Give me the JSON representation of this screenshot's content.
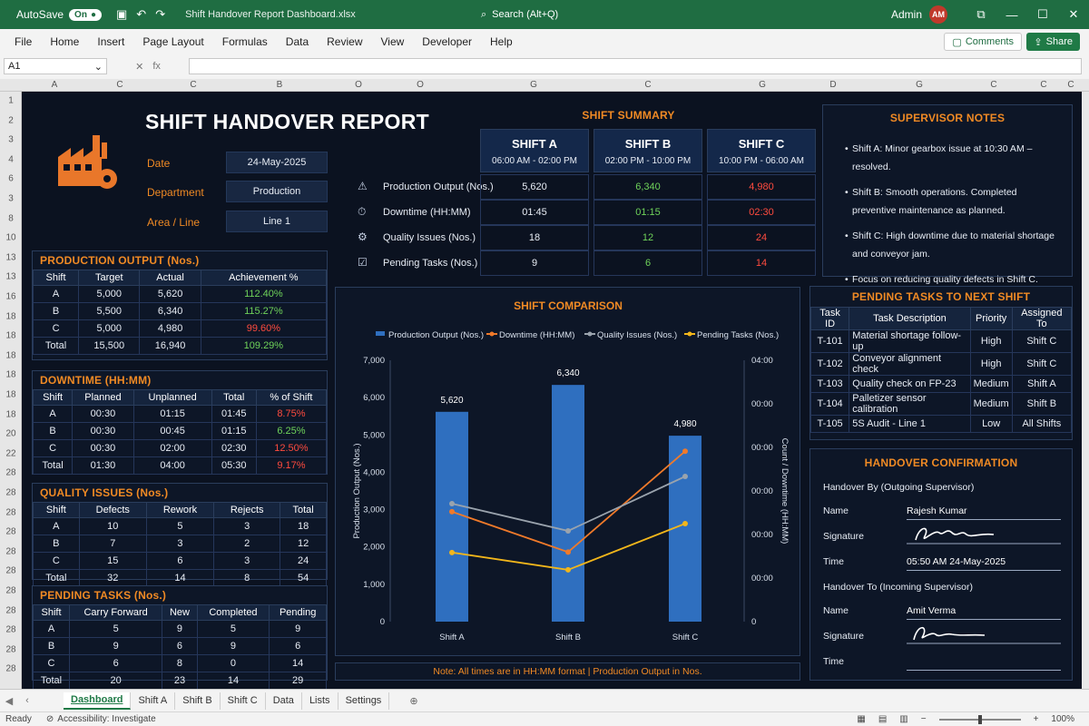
{
  "titlebar": {
    "autosave_label": "AutoSave",
    "autosave_state": "On",
    "doc_title": "Shift Handover Report Dashboard.xlsx",
    "search_placeholder": "Search (Alt+Q)",
    "user_name": "Admin",
    "user_initials": "AM"
  },
  "menu": [
    "File",
    "Home",
    "Insert",
    "Page Layout",
    "Formulas",
    "Data",
    "Review",
    "View",
    "Developer",
    "Help"
  ],
  "actions": {
    "comments": "Comments",
    "share": "Share"
  },
  "formula_bar": {
    "cell_ref": "A1",
    "fx": "fx"
  },
  "columns": [
    "A",
    "C",
    "C",
    "B",
    "O",
    "O",
    "G",
    "C",
    "G",
    "D",
    "G",
    "C",
    "C",
    "C"
  ],
  "rows": [
    "1",
    "2",
    "3",
    "4",
    "6",
    "3",
    "8",
    "10",
    "13",
    "13",
    "16",
    "18",
    "18",
    "18",
    "18",
    "18",
    "18",
    "20",
    "22",
    "28",
    "28",
    "28",
    "28",
    "28",
    "28",
    "28",
    "28",
    "28",
    "28",
    "28"
  ],
  "header": {
    "title": "SHIFT HANDOVER REPORT",
    "date_label": "Date",
    "date_value": "24-May-2025",
    "department_label": "Department",
    "department_value": "Production",
    "area_label": "Area / Line",
    "area_value": "Line 1"
  },
  "production": {
    "title": "PRODUCTION OUTPUT (Nos.)",
    "headers": [
      "Shift",
      "Target",
      "Actual",
      "Achievement %"
    ],
    "rows": [
      [
        "A",
        "5,000",
        "5,620",
        "112.40%"
      ],
      [
        "B",
        "5,500",
        "6,340",
        "115.27%"
      ],
      [
        "C",
        "5,000",
        "4,980",
        "99.60%"
      ],
      [
        "Total",
        "15,500",
        "16,940",
        "109.29%"
      ]
    ]
  },
  "downtime": {
    "title": "DOWNTIME (HH:MM)",
    "headers": [
      "Shift",
      "Planned",
      "Unplanned",
      "Total",
      "% of Shift"
    ],
    "rows": [
      [
        "A",
        "00:30",
        "01:15",
        "01:45",
        "8.75%"
      ],
      [
        "B",
        "00:30",
        "00:45",
        "01:15",
        "6.25%"
      ],
      [
        "C",
        "00:30",
        "02:00",
        "02:30",
        "12.50%"
      ],
      [
        "Total",
        "01:30",
        "04:00",
        "05:30",
        "9.17%"
      ]
    ]
  },
  "quality": {
    "title": "QUALITY ISSUES (Nos.)",
    "headers": [
      "Shift",
      "Defects",
      "Rework",
      "Rejects",
      "Total"
    ],
    "rows": [
      [
        "A",
        "10",
        "5",
        "3",
        "18"
      ],
      [
        "B",
        "7",
        "3",
        "2",
        "12"
      ],
      [
        "C",
        "15",
        "6",
        "3",
        "24"
      ],
      [
        "Total",
        "32",
        "14",
        "8",
        "54"
      ]
    ]
  },
  "pending": {
    "title": "PENDING TASKS (Nos.)",
    "headers": [
      "Shift",
      "Carry Forward",
      "New",
      "Completed",
      "Pending"
    ],
    "rows": [
      [
        "A",
        "5",
        "9",
        "5",
        "9"
      ],
      [
        "B",
        "9",
        "6",
        "9",
        "6"
      ],
      [
        "C",
        "6",
        "8",
        "0",
        "14"
      ],
      [
        "Total",
        "20",
        "23",
        "14",
        "29"
      ]
    ]
  },
  "summary": {
    "title": "SHIFT SUMMARY",
    "shifts": [
      {
        "name": "SHIFT A",
        "time": "06:00 AM - 02:00 PM"
      },
      {
        "name": "SHIFT B",
        "time": "02:00 PM - 10:00 PM"
      },
      {
        "name": "SHIFT C",
        "time": "10:00 PM - 06:00 AM"
      }
    ],
    "rows": [
      {
        "label": "Production Output (Nos.)",
        "values": [
          "5,620",
          "6,340",
          "4,980"
        ]
      },
      {
        "label": "Downtime (HH:MM)",
        "values": [
          "01:45",
          "01:15",
          "02:30"
        ]
      },
      {
        "label": "Quality Issues (Nos.)",
        "values": [
          "18",
          "12",
          "24"
        ]
      },
      {
        "label": "Pending Tasks (Nos.)",
        "values": [
          "9",
          "6",
          "14"
        ]
      }
    ]
  },
  "notes": {
    "title": "SUPERVISOR NOTES",
    "items": [
      "Shift A: Minor gearbox issue at 10:30 AM – resolved.",
      "Shift B: Smooth operations. Completed preventive maintenance as planned.",
      "Shift C: High downtime due to material shortage and conveyor jam.",
      "Focus on reducing quality defects in Shift C."
    ]
  },
  "chart_data": {
    "type": "bar",
    "title": "SHIFT COMPARISON",
    "categories": [
      "Shift A",
      "Shift B",
      "Shift C"
    ],
    "ylabel": "Production Output (Nos.)",
    "y2label": "Count / Downtime (HH:MM)",
    "ylim": [
      0,
      7000
    ],
    "yticks": [
      "0",
      "1,000",
      "2,000",
      "3,000",
      "4,000",
      "5,000",
      "6,000",
      "7,000"
    ],
    "y2ticks": [
      "0",
      "00:00",
      "00:00",
      "00:00",
      "00:00",
      "00:00",
      "04:00"
    ],
    "series": [
      {
        "name": "Production Output (Nos.)",
        "kind": "bar",
        "values": [
          5620,
          6340,
          4980
        ],
        "labels": [
          "5,620",
          "6,340",
          "4,980"
        ],
        "color": "#2f6fbf"
      },
      {
        "name": "Downtime (HH:MM)",
        "kind": "line",
        "values": [
          105,
          75,
          150
        ],
        "color": "#f07a2a"
      },
      {
        "name": "Quality Issues (Nos.)",
        "kind": "line",
        "values": [
          18,
          12,
          24
        ],
        "color": "#9aa3ad"
      },
      {
        "name": "Pending Tasks (Nos.)",
        "kind": "line",
        "values": [
          9,
          6,
          14
        ],
        "color": "#f2b61b"
      }
    ],
    "legend": "top",
    "grid": false
  },
  "chart_note": "Note: All times are in HH:MM format | Production Output in Nos.",
  "next_tasks": {
    "title": "PENDING TASKS TO NEXT SHIFT",
    "headers": [
      "Task ID",
      "Task Description",
      "Priority",
      "Assigned To"
    ],
    "rows": [
      [
        "T-101",
        "Material shortage follow-up",
        "High",
        "Shift C"
      ],
      [
        "T-102",
        "Conveyor alignment check",
        "High",
        "Shift C"
      ],
      [
        "T-103",
        "Quality check on FP-23",
        "Medium",
        "Shift A"
      ],
      [
        "T-104",
        "Palletizer sensor calibration",
        "Medium",
        "Shift B"
      ],
      [
        "T-105",
        "5S Audit - Line 1",
        "Low",
        "All Shifts"
      ]
    ]
  },
  "handover": {
    "title": "HANDOVER CONFIRMATION",
    "by_label": "Handover By (Outgoing Supervisor)",
    "to_label": "Handover To (Incoming Supervisor)",
    "name_label": "Name",
    "signature_label": "Signature",
    "time_label": "Time",
    "by_name": "Rajesh Kumar",
    "by_time": "05:50 AM 24-May-2025",
    "to_name": "Amit Verma"
  },
  "sheets": [
    "Dashboard",
    "Shift A",
    "Shift B",
    "Shift C",
    "Data",
    "Lists",
    "Settings"
  ],
  "status": {
    "ready": "Ready",
    "accessibility": "Accessibility: Investigate",
    "zoom": "100%"
  },
  "colors": {
    "bg": "#0b1220",
    "accent": "#f08a24",
    "green": "#6fd35a",
    "red": "#ff4b3e",
    "excel_green": "#1f6d42"
  }
}
